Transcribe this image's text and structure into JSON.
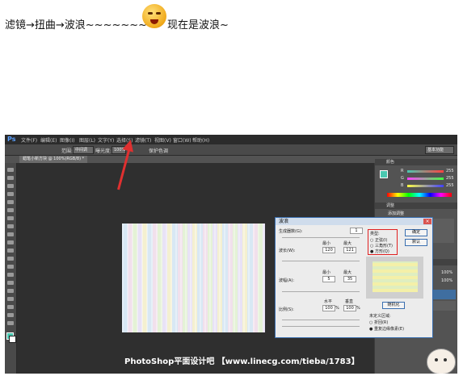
{
  "caption": {
    "line_start": "滤镜→扭曲→波浪~~~~~~~",
    "line_end": "现在是波浪~"
  },
  "photoshop": {
    "app_logo": "Ps",
    "menu": [
      "文件(F)",
      "编辑(E)",
      "图像(I)",
      "图层(L)",
      "文字(Y)",
      "选择(S)",
      "滤镜(T)",
      "视图(V)",
      "窗口(W)",
      "帮助(H)"
    ],
    "options": {
      "area_label": "范围:",
      "area_value": "中间调",
      "exposure_label": "曝光度:",
      "exposure_value": "100%",
      "protect_tone": "保护色调",
      "workspace": "基本功能"
    },
    "doc_tab": "蜡笔小新方块 @ 100%(RGB/8) *",
    "panels": {
      "color_title": "颜色",
      "r": "255",
      "g": "255",
      "b": "255",
      "adjust_title": "调整",
      "add_adjust": "添加调整",
      "layers_value_1": "100%",
      "layers_value_2": "100%"
    },
    "dialog": {
      "title": "波浪",
      "generators_label": "生成器数(G):",
      "generators_value": "1",
      "wavelength_label": "波长(W):",
      "min_label": "最小",
      "max_label": "最大",
      "wavelength_min": "120",
      "wavelength_max": "121",
      "amplitude_label": "波幅(A):",
      "amplitude_min": "5",
      "amplitude_max": "35",
      "scale_label": "比例(S):",
      "horizontal_label": "水平",
      "vertical_label": "垂直",
      "scale_h": "100",
      "scale_v": "100",
      "pct_h": "%",
      "pct_v": "%",
      "type_label": "类型:",
      "type_sine": "正弦(I)",
      "type_triangle": "三角形(T)",
      "type_square": "方形(Q)",
      "ok_button": "确定",
      "default_button": "默认",
      "randomize_button": "随机化",
      "undefined_label": "未定义区域:",
      "wrap_around": "折回(R)",
      "repeat_edge": "重复边缘像素(E)"
    },
    "banner": "PhotoShop平面设计吧 【www.linecg.com/tieba/1783】"
  },
  "colors": {
    "ps_bg": "#3c3c3c",
    "dialog_bg": "#ececec",
    "highlight_red": "#e02020",
    "swatch": "#49c8b0"
  }
}
